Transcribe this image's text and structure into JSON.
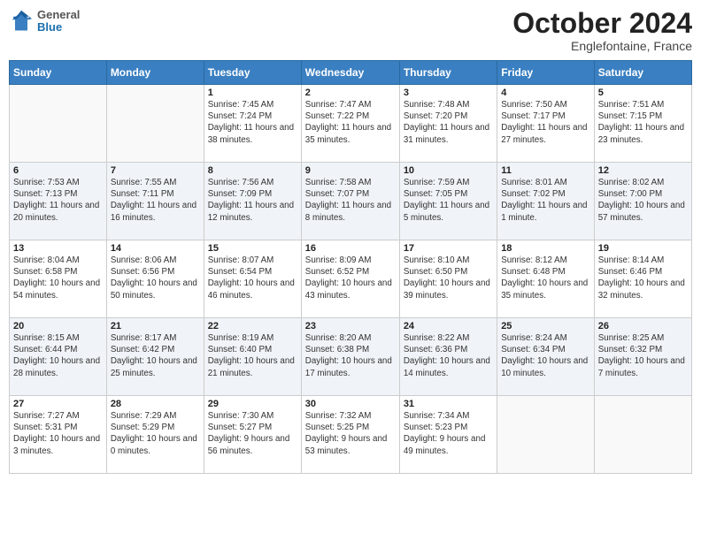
{
  "logo": {
    "general": "General",
    "blue": "Blue"
  },
  "header": {
    "title": "October 2024",
    "location": "Englefontaine, France"
  },
  "weekdays": [
    "Sunday",
    "Monday",
    "Tuesday",
    "Wednesday",
    "Thursday",
    "Friday",
    "Saturday"
  ],
  "weeks": [
    [
      {
        "day": "",
        "sunrise": "",
        "sunset": "",
        "daylight": ""
      },
      {
        "day": "",
        "sunrise": "",
        "sunset": "",
        "daylight": ""
      },
      {
        "day": "1",
        "sunrise": "Sunrise: 7:45 AM",
        "sunset": "Sunset: 7:24 PM",
        "daylight": "Daylight: 11 hours and 38 minutes."
      },
      {
        "day": "2",
        "sunrise": "Sunrise: 7:47 AM",
        "sunset": "Sunset: 7:22 PM",
        "daylight": "Daylight: 11 hours and 35 minutes."
      },
      {
        "day": "3",
        "sunrise": "Sunrise: 7:48 AM",
        "sunset": "Sunset: 7:20 PM",
        "daylight": "Daylight: 11 hours and 31 minutes."
      },
      {
        "day": "4",
        "sunrise": "Sunrise: 7:50 AM",
        "sunset": "Sunset: 7:17 PM",
        "daylight": "Daylight: 11 hours and 27 minutes."
      },
      {
        "day": "5",
        "sunrise": "Sunrise: 7:51 AM",
        "sunset": "Sunset: 7:15 PM",
        "daylight": "Daylight: 11 hours and 23 minutes."
      }
    ],
    [
      {
        "day": "6",
        "sunrise": "Sunrise: 7:53 AM",
        "sunset": "Sunset: 7:13 PM",
        "daylight": "Daylight: 11 hours and 20 minutes."
      },
      {
        "day": "7",
        "sunrise": "Sunrise: 7:55 AM",
        "sunset": "Sunset: 7:11 PM",
        "daylight": "Daylight: 11 hours and 16 minutes."
      },
      {
        "day": "8",
        "sunrise": "Sunrise: 7:56 AM",
        "sunset": "Sunset: 7:09 PM",
        "daylight": "Daylight: 11 hours and 12 minutes."
      },
      {
        "day": "9",
        "sunrise": "Sunrise: 7:58 AM",
        "sunset": "Sunset: 7:07 PM",
        "daylight": "Daylight: 11 hours and 8 minutes."
      },
      {
        "day": "10",
        "sunrise": "Sunrise: 7:59 AM",
        "sunset": "Sunset: 7:05 PM",
        "daylight": "Daylight: 11 hours and 5 minutes."
      },
      {
        "day": "11",
        "sunrise": "Sunrise: 8:01 AM",
        "sunset": "Sunset: 7:02 PM",
        "daylight": "Daylight: 11 hours and 1 minute."
      },
      {
        "day": "12",
        "sunrise": "Sunrise: 8:02 AM",
        "sunset": "Sunset: 7:00 PM",
        "daylight": "Daylight: 10 hours and 57 minutes."
      }
    ],
    [
      {
        "day": "13",
        "sunrise": "Sunrise: 8:04 AM",
        "sunset": "Sunset: 6:58 PM",
        "daylight": "Daylight: 10 hours and 54 minutes."
      },
      {
        "day": "14",
        "sunrise": "Sunrise: 8:06 AM",
        "sunset": "Sunset: 6:56 PM",
        "daylight": "Daylight: 10 hours and 50 minutes."
      },
      {
        "day": "15",
        "sunrise": "Sunrise: 8:07 AM",
        "sunset": "Sunset: 6:54 PM",
        "daylight": "Daylight: 10 hours and 46 minutes."
      },
      {
        "day": "16",
        "sunrise": "Sunrise: 8:09 AM",
        "sunset": "Sunset: 6:52 PM",
        "daylight": "Daylight: 10 hours and 43 minutes."
      },
      {
        "day": "17",
        "sunrise": "Sunrise: 8:10 AM",
        "sunset": "Sunset: 6:50 PM",
        "daylight": "Daylight: 10 hours and 39 minutes."
      },
      {
        "day": "18",
        "sunrise": "Sunrise: 8:12 AM",
        "sunset": "Sunset: 6:48 PM",
        "daylight": "Daylight: 10 hours and 35 minutes."
      },
      {
        "day": "19",
        "sunrise": "Sunrise: 8:14 AM",
        "sunset": "Sunset: 6:46 PM",
        "daylight": "Daylight: 10 hours and 32 minutes."
      }
    ],
    [
      {
        "day": "20",
        "sunrise": "Sunrise: 8:15 AM",
        "sunset": "Sunset: 6:44 PM",
        "daylight": "Daylight: 10 hours and 28 minutes."
      },
      {
        "day": "21",
        "sunrise": "Sunrise: 8:17 AM",
        "sunset": "Sunset: 6:42 PM",
        "daylight": "Daylight: 10 hours and 25 minutes."
      },
      {
        "day": "22",
        "sunrise": "Sunrise: 8:19 AM",
        "sunset": "Sunset: 6:40 PM",
        "daylight": "Daylight: 10 hours and 21 minutes."
      },
      {
        "day": "23",
        "sunrise": "Sunrise: 8:20 AM",
        "sunset": "Sunset: 6:38 PM",
        "daylight": "Daylight: 10 hours and 17 minutes."
      },
      {
        "day": "24",
        "sunrise": "Sunrise: 8:22 AM",
        "sunset": "Sunset: 6:36 PM",
        "daylight": "Daylight: 10 hours and 14 minutes."
      },
      {
        "day": "25",
        "sunrise": "Sunrise: 8:24 AM",
        "sunset": "Sunset: 6:34 PM",
        "daylight": "Daylight: 10 hours and 10 minutes."
      },
      {
        "day": "26",
        "sunrise": "Sunrise: 8:25 AM",
        "sunset": "Sunset: 6:32 PM",
        "daylight": "Daylight: 10 hours and 7 minutes."
      }
    ],
    [
      {
        "day": "27",
        "sunrise": "Sunrise: 7:27 AM",
        "sunset": "Sunset: 5:31 PM",
        "daylight": "Daylight: 10 hours and 3 minutes."
      },
      {
        "day": "28",
        "sunrise": "Sunrise: 7:29 AM",
        "sunset": "Sunset: 5:29 PM",
        "daylight": "Daylight: 10 hours and 0 minutes."
      },
      {
        "day": "29",
        "sunrise": "Sunrise: 7:30 AM",
        "sunset": "Sunset: 5:27 PM",
        "daylight": "Daylight: 9 hours and 56 minutes."
      },
      {
        "day": "30",
        "sunrise": "Sunrise: 7:32 AM",
        "sunset": "Sunset: 5:25 PM",
        "daylight": "Daylight: 9 hours and 53 minutes."
      },
      {
        "day": "31",
        "sunrise": "Sunrise: 7:34 AM",
        "sunset": "Sunset: 5:23 PM",
        "daylight": "Daylight: 9 hours and 49 minutes."
      },
      {
        "day": "",
        "sunrise": "",
        "sunset": "",
        "daylight": ""
      },
      {
        "day": "",
        "sunrise": "",
        "sunset": "",
        "daylight": ""
      }
    ]
  ]
}
